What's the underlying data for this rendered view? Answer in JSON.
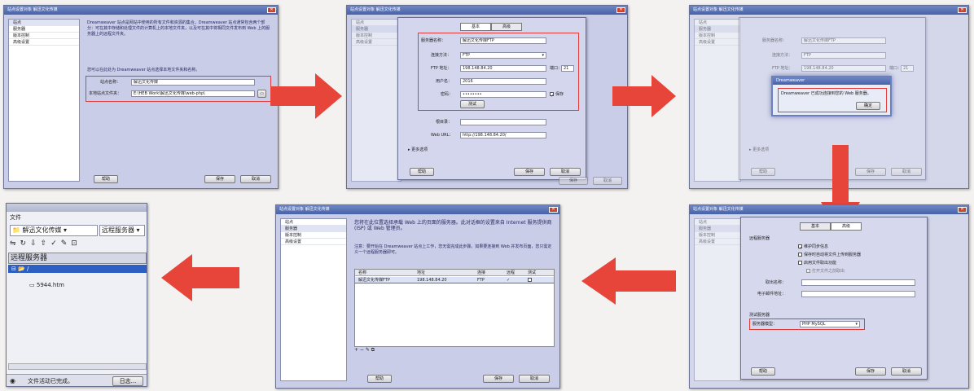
{
  "colors": {
    "accent": "#e23b3b",
    "window_bg": "#c9cde8",
    "title_bar": "#4662a8"
  },
  "site_dialog": {
    "title": "站点设置对象 解迅文化传媒",
    "sidebar": [
      "站点",
      "服务器",
      "版本控制",
      "高级设置"
    ],
    "help": "帮助",
    "save": "保存",
    "cancel": "取消"
  },
  "panel1": {
    "intro": "Dreamweaver 站点是网站中使用的所有文件和资源的集合。Dreamweaver 站点通常包含两个部分：可在其中存储和处理文件的计算机上的本地文件夹，以及可在其中将相同文件发布到 Web 上的服务器上的远程文件夹。",
    "choose": "您可以在此处为 Dreamweaver 站点选择本地文件夹和名称。",
    "site_name_label": "站点名称：",
    "site_name_value": "解迅文化传媒",
    "local_folder_label": "本地站点文件夹：",
    "local_folder_value": "E:\\HEB Work\\解迅文化传媒\\web-php\\"
  },
  "panel2": {
    "tab_basic": "基本",
    "tab_advanced": "高级",
    "server_name_label": "服务器名称：",
    "server_name_value": "解迅文化传媒FTP",
    "connect_label": "连接方法：",
    "connect_value": "FTP",
    "ftp_label": "FTP 地址：",
    "ftp_value": "198.148.84.20",
    "port_label": "端口：",
    "port_value": "21",
    "user_label": "用户名：",
    "user_value": "2016",
    "pass_label": "密码：",
    "pass_value": "••••••••",
    "save_check": "保存",
    "test": "测试",
    "root_label": "根目录：",
    "root_value": "",
    "weburl_label": "Web URL：",
    "weburl_value": "http://198.148.84.20/",
    "more": "更多选项",
    "help": "帮助",
    "save": "保存",
    "cancel": "取消"
  },
  "panel3": {
    "dialog_title": "Dreamweaver",
    "message": "Dreamweaver 已成功连接到您的 Web 服务器。",
    "ok": "确定",
    "behind_server": "服务器名称：",
    "behind_server_value": "解迅文化传媒FTP",
    "behind_connect": "连接方法：",
    "behind_connect_value": "FTP",
    "behind_ftp": "FTP 地址：",
    "behind_ftp_value": "198.148.84.20",
    "behind_port": "端口：",
    "behind_port_value": "21",
    "more": "更多选项",
    "help": "帮助",
    "save": "保存",
    "cancel": "取消"
  },
  "panel4": {
    "tab_basic": "基本",
    "tab_advanced": "高级",
    "remote_header": "远程服务器",
    "opt1": "维护同步信息",
    "opt2": "保存时自动将文件上传到服务器",
    "opt3": "启用文件取出功能",
    "opt4": "打开文件之前取出",
    "checkout_label": "取出名称：",
    "email_label": "电子邮件地址：",
    "test_header": "测试服务器",
    "server_model_label": "服务器模型：",
    "server_model_value": "PHP MySQL",
    "help": "帮助",
    "save": "保存",
    "cancel": "取消"
  },
  "panel5": {
    "intro": "您将在此位置选择承载 Web 上的页面的服务器。此对话框的设置来自 Internet 服务提供商 (ISP) 或 Web 管理员。",
    "note": "注意：要开始在 Dreamweaver 站点上工作，您无需完成此步骤。如果要连接到 Web 并发布页面，您只需定义一个远程服务器即可。",
    "columns": [
      "名称",
      "地址",
      "连接",
      "远程",
      "测试"
    ],
    "row": {
      "name": "解迅文化传媒FTP",
      "address": "198.148.84.20",
      "conn": "FTP",
      "remote": "✓",
      "test": ""
    },
    "tools": "+ − ✎ ⧉",
    "help": "帮助",
    "save": "保存",
    "cancel": "取消"
  },
  "panel6": {
    "header": "文件",
    "site_select": "解迅文化传媒",
    "view_select": "远程服务器",
    "section": "远程服务器",
    "root": "/",
    "file": "5944.htm",
    "status": "文件活动已完成。",
    "log": "日志..."
  }
}
